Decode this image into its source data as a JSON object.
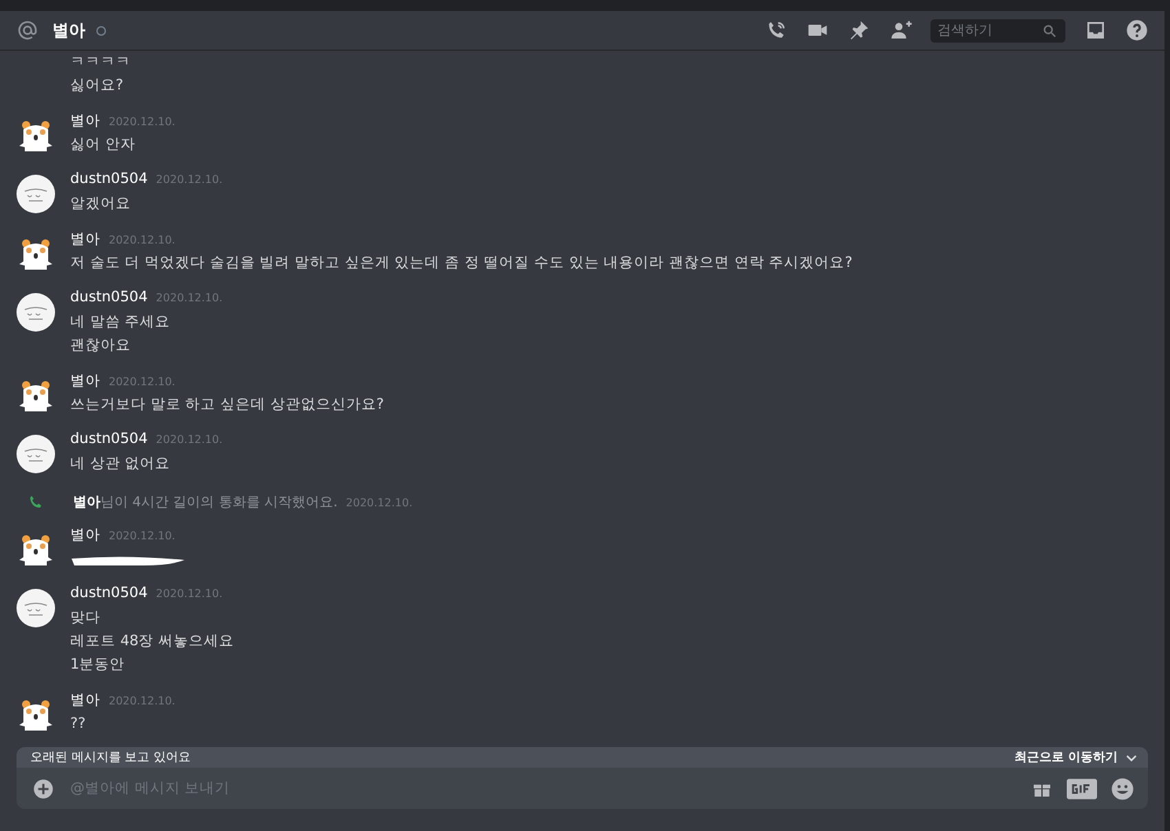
{
  "header": {
    "channel": "별아",
    "online": false,
    "search": {
      "placeholder": "검색하기"
    }
  },
  "messages": [
    {
      "kind": "continuation",
      "lines": [
        {
          "kind": "text",
          "text": "ㅋㅋㅋㅋ"
        },
        {
          "kind": "text",
          "text": "싫어요?"
        }
      ]
    },
    {
      "kind": "message",
      "author": "별아",
      "avatar": {
        "kind": "hamster"
      },
      "time": "2020.12.10.",
      "lines": [
        {
          "kind": "text",
          "text": "싫어 안자"
        }
      ]
    },
    {
      "kind": "message",
      "author": "dustn0504",
      "avatar": {
        "kind": "sketch"
      },
      "time": "2020.12.10.",
      "lines": [
        {
          "kind": "text",
          "text": "알겠어요"
        }
      ]
    },
    {
      "kind": "message",
      "author": "별아",
      "avatar": {
        "kind": "hamster"
      },
      "time": "2020.12.10.",
      "lines": [
        {
          "kind": "text",
          "text": "저 술도 더 먹었겠다 술김을 빌려 말하고 싶은게 있는데 좀 정 떨어질 수도 있는 내용이라 괜찮으면 연락 주시겠어요?"
        }
      ]
    },
    {
      "kind": "message",
      "author": "dustn0504",
      "avatar": {
        "kind": "sketch"
      },
      "time": "2020.12.10.",
      "lines": [
        {
          "kind": "text",
          "text": "네 말씀 주세요"
        },
        {
          "kind": "text",
          "text": "괜찮아요"
        }
      ]
    },
    {
      "kind": "message",
      "author": "별아",
      "avatar": {
        "kind": "hamster"
      },
      "time": "2020.12.10.",
      "lines": [
        {
          "kind": "text",
          "text": "쓰는거보다 말로 하고 싶은데 상관없으신가요?"
        }
      ]
    },
    {
      "kind": "message",
      "author": "dustn0504",
      "avatar": {
        "kind": "sketch"
      },
      "time": "2020.12.10.",
      "lines": [
        {
          "kind": "text",
          "text": "네 상관 없어요"
        }
      ]
    },
    {
      "kind": "call",
      "author": "별아",
      "text": "님이 4시간 길이의 통화를 시작했어요.",
      "time": "2020.12.10."
    },
    {
      "kind": "message",
      "author": "별아",
      "avatar": {
        "kind": "hamster"
      },
      "time": "2020.12.10.",
      "lines": [
        {
          "kind": "redacted"
        }
      ]
    },
    {
      "kind": "message",
      "author": "dustn0504",
      "avatar": {
        "kind": "sketch"
      },
      "time": "2020.12.10.",
      "lines": [
        {
          "kind": "text",
          "text": "맞다"
        },
        {
          "kind": "text",
          "text": "레포트 48장 써놓으세요"
        },
        {
          "kind": "text",
          "text": "1분동안"
        }
      ]
    },
    {
      "kind": "message",
      "author": "별아",
      "avatar": {
        "kind": "hamster"
      },
      "time": "2020.12.10.",
      "lines": [
        {
          "kind": "text",
          "text": "??"
        }
      ]
    }
  ],
  "banner": {
    "text": "오래된 메시지를 보고 있어요",
    "action": "최근으로 이동하기"
  },
  "composer": {
    "placeholder": "@별아에 메시지 보내기"
  }
}
